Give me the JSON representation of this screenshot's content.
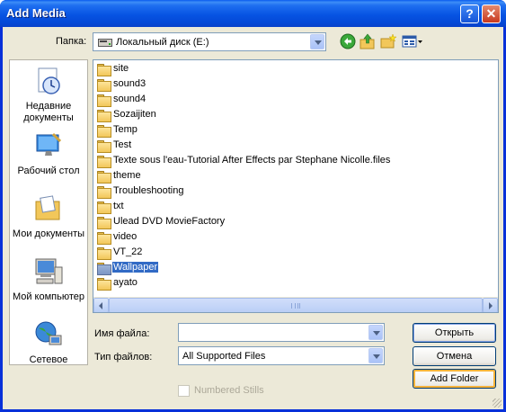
{
  "window": {
    "title": "Add Media"
  },
  "titlebar_buttons": {
    "help": "?",
    "close": "✕"
  },
  "folder_label": "Папка:",
  "folder_path": "Локальный диск (E:)",
  "places": [
    {
      "name": "recent-documents",
      "label": "Недавние документы"
    },
    {
      "name": "desktop",
      "label": "Рабочий стол"
    },
    {
      "name": "my-documents",
      "label": "Мои документы"
    },
    {
      "name": "my-computer",
      "label": "Мой компьютер"
    },
    {
      "name": "network",
      "label": "Сетевое"
    }
  ],
  "files": [
    "site",
    "sound3",
    "sound4",
    "Sozaijiten",
    "Temp",
    "Test",
    "Texte sous l'eau-Tutorial After Effects par Stephane Nicolle.files",
    "theme",
    "Troubleshooting",
    "txt",
    "Ulead DVD MovieFactory",
    "video",
    "VT_22",
    "Wallpaper",
    "ayato"
  ],
  "selected_file": "Wallpaper",
  "filename": {
    "label": "Имя файла:",
    "value": ""
  },
  "filetype": {
    "label": "Тип файлов:",
    "value": "All Supported Files"
  },
  "buttons": {
    "open": "Открыть",
    "cancel": "Отмена",
    "add_folder": "Add Folder"
  },
  "numbered_stills": {
    "label": "Numbered Stills",
    "checked": false,
    "enabled": false
  },
  "colors": {
    "title_bar": "#0754e3",
    "selection": "#316ac5",
    "dialog_bg": "#ece9d8"
  }
}
